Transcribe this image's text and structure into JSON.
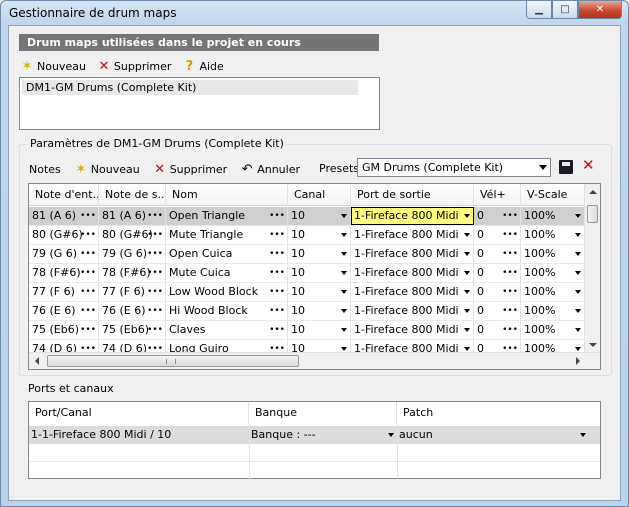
{
  "window": {
    "title": "Gestionnaire de drum maps"
  },
  "section_header": "Drum maps utilisées dans le projet en cours",
  "toolbar1": {
    "new": "Nouveau",
    "delete": "Supprimer",
    "help": "Aide"
  },
  "drum_maps": [
    "DM1-GM Drums (Complete Kit)"
  ],
  "params_legend": "Paramètres de DM1-GM Drums (Complete Kit)",
  "toolbar2": {
    "notes": "Notes",
    "new": "Nouveau",
    "delete": "Supprimer",
    "undo": "Annuler",
    "presets": "Presets",
    "preset_value": "GM Drums (Complete Kit)"
  },
  "grid": {
    "columns": [
      "Note d'ent...",
      "Note de s...",
      "Nom",
      "Canal",
      "Port de sortie",
      "Vél+",
      "V-Scale"
    ],
    "rows": [
      [
        "81 (A 6)",
        "81 (A 6)",
        "Open Triangle",
        "10",
        "1-Fireface 800 Midi",
        "0",
        "100%"
      ],
      [
        "80 (G#6)",
        "80 (G#6)",
        "Mute Triangle",
        "10",
        "1-Fireface 800 Midi",
        "0",
        "100%"
      ],
      [
        "79 (G 6)",
        "79 (G 6)",
        "Open Cuica",
        "10",
        "1-Fireface 800 Midi",
        "0",
        "100%"
      ],
      [
        "78 (F#6)",
        "78 (F#6)",
        "Mute Cuica",
        "10",
        "1-Fireface 800 Midi",
        "0",
        "100%"
      ],
      [
        "77 (F 6)",
        "77 (F 6)",
        "Low Wood Block",
        "10",
        "1-Fireface 800 Midi",
        "0",
        "100%"
      ],
      [
        "76 (E 6)",
        "76 (E 6)",
        "Hi Wood Block",
        "10",
        "1-Fireface 800 Midi",
        "0",
        "100%"
      ],
      [
        "75 (Eb6)",
        "75 (Eb6)",
        "Claves",
        "10",
        "1-Fireface 800 Midi",
        "0",
        "100%"
      ],
      [
        "74 (D 6)",
        "74 (D 6)",
        "Long Guiro",
        "10",
        "1-Fireface 800 Midi",
        "0",
        "100%"
      ]
    ]
  },
  "ports": {
    "label": "Ports et canaux",
    "columns": [
      "Port/Canal",
      "Banque",
      "Patch"
    ],
    "rows": [
      [
        "1-1-Fireface 800 Midi / 10",
        "Banque : ---",
        "aucun"
      ]
    ]
  }
}
